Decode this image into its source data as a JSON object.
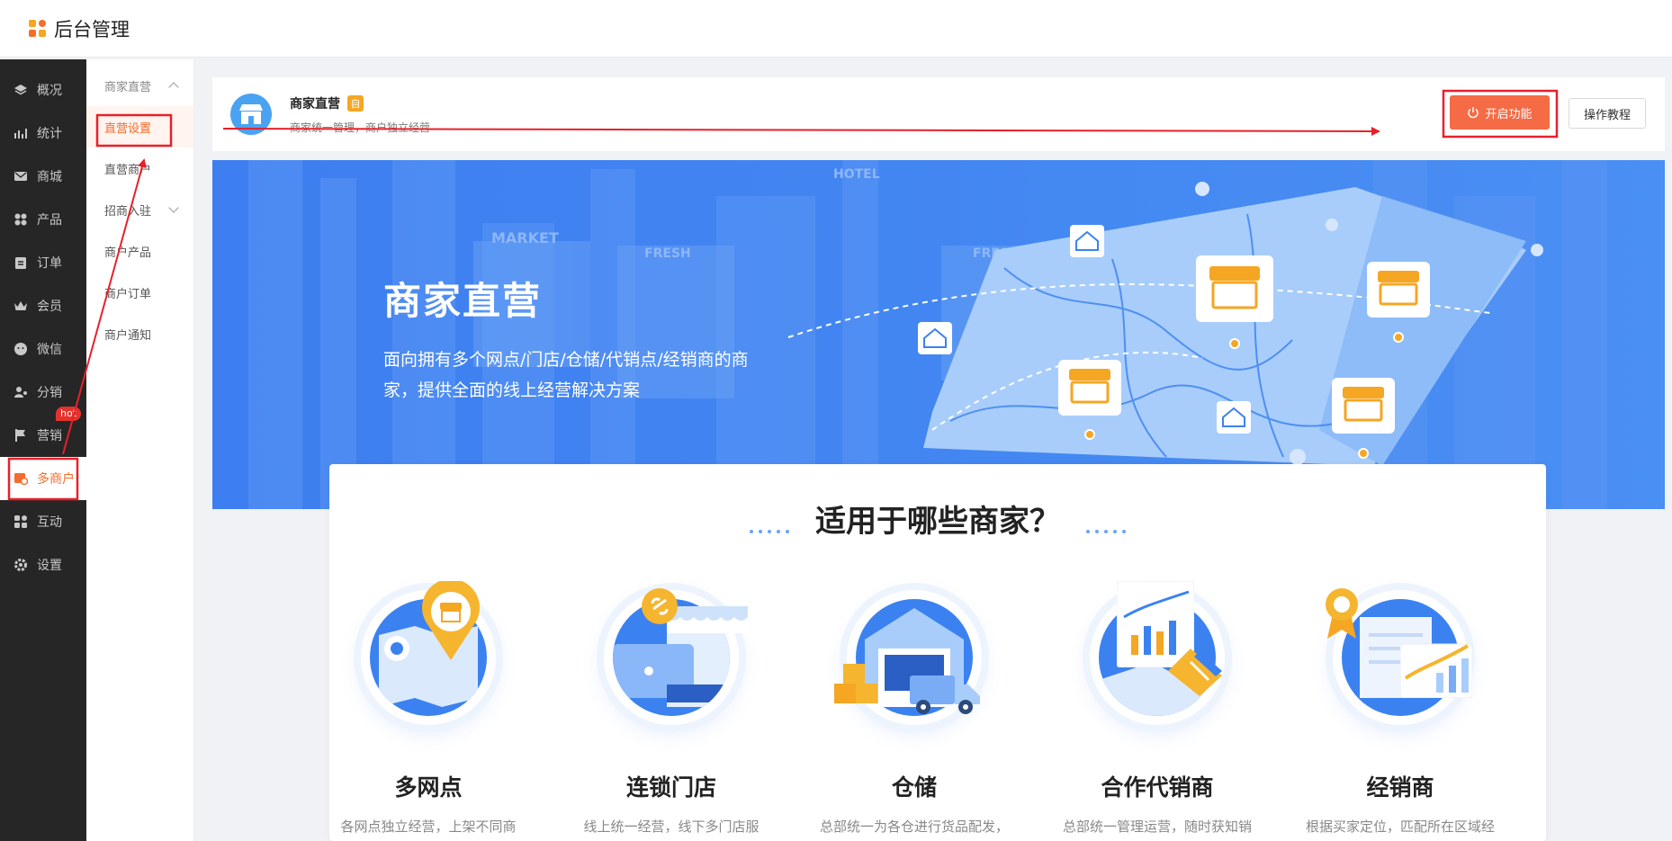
{
  "app": {
    "title": "后台管理"
  },
  "sidebar": {
    "items": [
      {
        "label": "概况",
        "icon": "layers-icon"
      },
      {
        "label": "统计",
        "icon": "chart-icon"
      },
      {
        "label": "商城",
        "icon": "mail-icon"
      },
      {
        "label": "产品",
        "icon": "grid-icon"
      },
      {
        "label": "订单",
        "icon": "clipboard-icon"
      },
      {
        "label": "会员",
        "icon": "crown-icon"
      },
      {
        "label": "微信",
        "icon": "wechat-icon"
      },
      {
        "label": "分销",
        "icon": "user-share-icon"
      },
      {
        "label": "营销",
        "icon": "flag-icon",
        "badge": "hot"
      },
      {
        "label": "多商户",
        "icon": "multi-shop-icon",
        "active": true
      },
      {
        "label": "互动",
        "icon": "people-icon"
      },
      {
        "label": "设置",
        "icon": "gear-icon"
      }
    ]
  },
  "submenu": {
    "group1": "商家直营",
    "item_settings": "直营设置",
    "item_merchants": "直营商户",
    "group2": "招商入驻",
    "item_products": "商户产品",
    "item_orders": "商户订单",
    "item_notice": "商户通知"
  },
  "header": {
    "title": "商家直营",
    "badge": "自",
    "subtitle": "商家统一管理，商户独立经营",
    "enable_button": "开启功能",
    "tutorial_button": "操作教程"
  },
  "banner": {
    "title": "商家直营",
    "description": "面向拥有多个网点/门店/仓储/代销点/经销商的商家，提供全面的线上经营解决方案",
    "sign_market": "MARKET",
    "sign_fresh": "FRESH",
    "sign_hotel": "HOTEL"
  },
  "features_section": {
    "heading": "适用于哪些商家？",
    "items": [
      {
        "name": "多网点",
        "desc": "各网点独立经营，上架不同商"
      },
      {
        "name": "连锁门店",
        "desc": "线上统一经营，线下多门店服"
      },
      {
        "name": "仓储",
        "desc": "总部统一为各仓进行货品配发，"
      },
      {
        "name": "合作代销商",
        "desc": "总部统一管理运营，随时获知销"
      },
      {
        "name": "经销商",
        "desc": "根据买家定位，匹配所在区域经"
      }
    ]
  },
  "colors": {
    "accent": "#f46b45",
    "sidebar_bg": "#262626",
    "banner_blue": "#4488f2",
    "annotation_red": "#e8202a"
  }
}
